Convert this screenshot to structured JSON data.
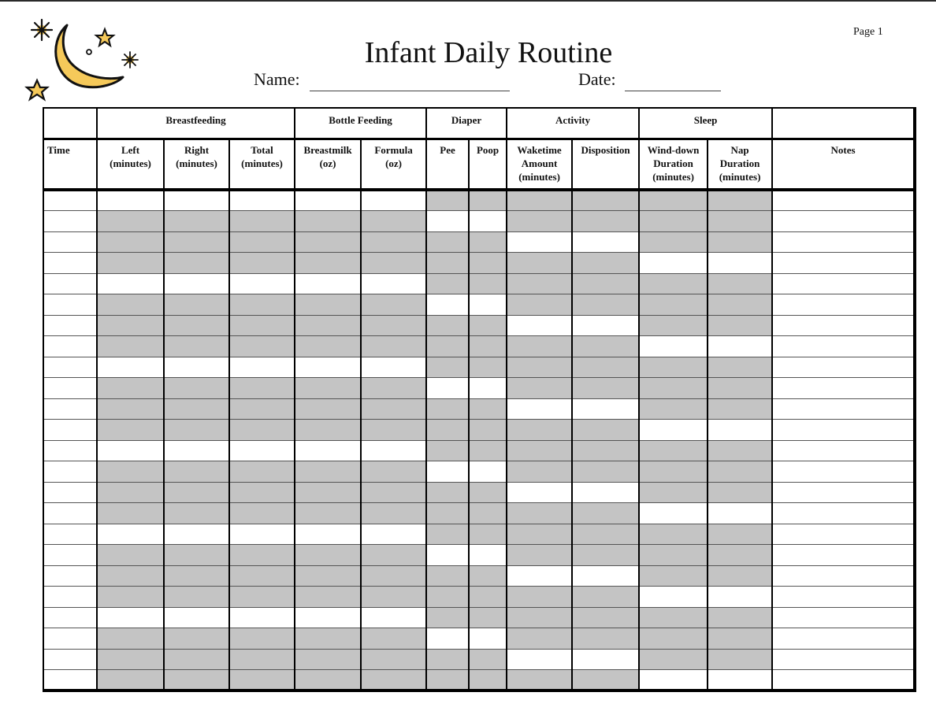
{
  "header": {
    "title": "Infant Daily Routine",
    "page_label": "Page 1",
    "name_label": "Name:",
    "name_value": "",
    "date_label": "Date:",
    "date_value": "",
    "logo_icon": "moon-and-stars-icon"
  },
  "colors": {
    "shade": "#c4c4c4",
    "logo_fill": "#f5c95a"
  },
  "table": {
    "groups": [
      {
        "label": "",
        "span": 1
      },
      {
        "label": "Breastfeeding",
        "span": 3
      },
      {
        "label": "Bottle Feeding",
        "span": 2
      },
      {
        "label": "Diaper",
        "span": 2
      },
      {
        "label": "Activity",
        "span": 2
      },
      {
        "label": "Sleep",
        "span": 2
      },
      {
        "label": "",
        "span": 1
      }
    ],
    "columns": [
      {
        "key": "time",
        "lines": [
          "Time"
        ],
        "group": "none"
      },
      {
        "key": "left",
        "lines": [
          "Left",
          "(minutes)"
        ],
        "group": "breastfeeding"
      },
      {
        "key": "right",
        "lines": [
          "Right",
          "(minutes)"
        ],
        "group": "breastfeeding"
      },
      {
        "key": "total",
        "lines": [
          "Total",
          "(minutes)"
        ],
        "group": "breastfeeding"
      },
      {
        "key": "breastmilk",
        "lines": [
          "Breastmilk",
          "(oz)"
        ],
        "group": "bottle"
      },
      {
        "key": "formula",
        "lines": [
          "Formula",
          "(oz)"
        ],
        "group": "bottle"
      },
      {
        "key": "pee",
        "lines": [
          "Pee"
        ],
        "group": "diaper"
      },
      {
        "key": "poop",
        "lines": [
          "Poop"
        ],
        "group": "diaper"
      },
      {
        "key": "waketime",
        "lines": [
          "Waketime",
          "Amount",
          "(minutes)"
        ],
        "group": "activity"
      },
      {
        "key": "disposition",
        "lines": [
          "Disposition"
        ],
        "group": "activity"
      },
      {
        "key": "winddown",
        "lines": [
          "Wind-down",
          "Duration",
          "(minutes)"
        ],
        "group": "sleep"
      },
      {
        "key": "nap",
        "lines": [
          "Nap",
          "Duration",
          "(minutes)"
        ],
        "group": "sleep"
      },
      {
        "key": "notes",
        "lines": [
          "Notes"
        ],
        "group": "none"
      }
    ],
    "row_count": 24,
    "open_row_cycle": {
      "cycle_length": 4,
      "breastfeeding": 0,
      "bottle": 0,
      "diaper": 1,
      "activity": 2,
      "sleep": 3
    },
    "rows": []
  }
}
